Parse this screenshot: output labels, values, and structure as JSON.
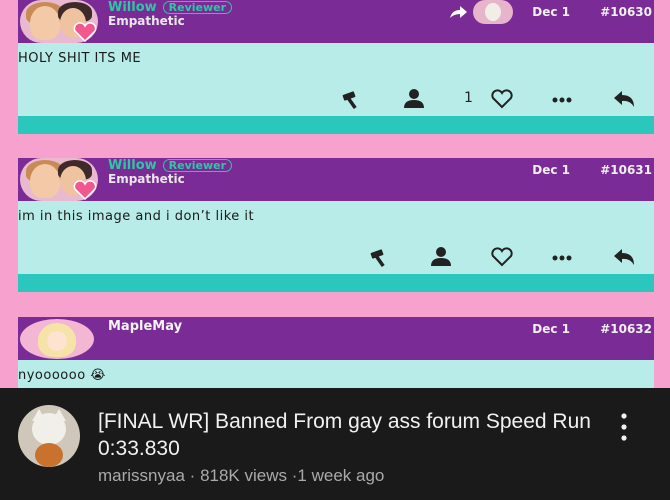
{
  "posts": [
    {
      "username": "Willow",
      "badge": "Reviewer",
      "usertitle": "Empathetic",
      "date": "Dec 1",
      "number": "#10630",
      "text": "HOLY SHIT ITS ME",
      "like_count": "1"
    },
    {
      "username": "Willow",
      "badge": "Reviewer",
      "usertitle": "Empathetic",
      "date": "Dec 1",
      "number": "#10631",
      "text": "im in this image and i don’t like it",
      "like_count": ""
    },
    {
      "username": "MapleMay",
      "date": "Dec 1",
      "number": "#10632",
      "text": "nyoooooo 😭"
    }
  ],
  "video": {
    "title": "[FINAL WR] Banned From gay ass forum Speed Run 0:33.830",
    "channel": "marissnyaa",
    "separator": "·",
    "views": "818K views",
    "age": "1 week ago"
  },
  "icons": {
    "hammer": "hammer-icon",
    "user": "user-icon",
    "heart": "heart-icon",
    "more": "more-dots-icon",
    "reply": "reply-arrow-icon",
    "share": "share-arrow-icon",
    "menu": "vertical-dots-icon"
  },
  "colors": {
    "page_bg": "#f7a1cf",
    "header_bg": "#7b2b95",
    "body_bg": "#b8ece8",
    "footer_bg": "#2bc6bc",
    "username": "#29c9a4",
    "yt_bg": "#1a1a1a"
  }
}
